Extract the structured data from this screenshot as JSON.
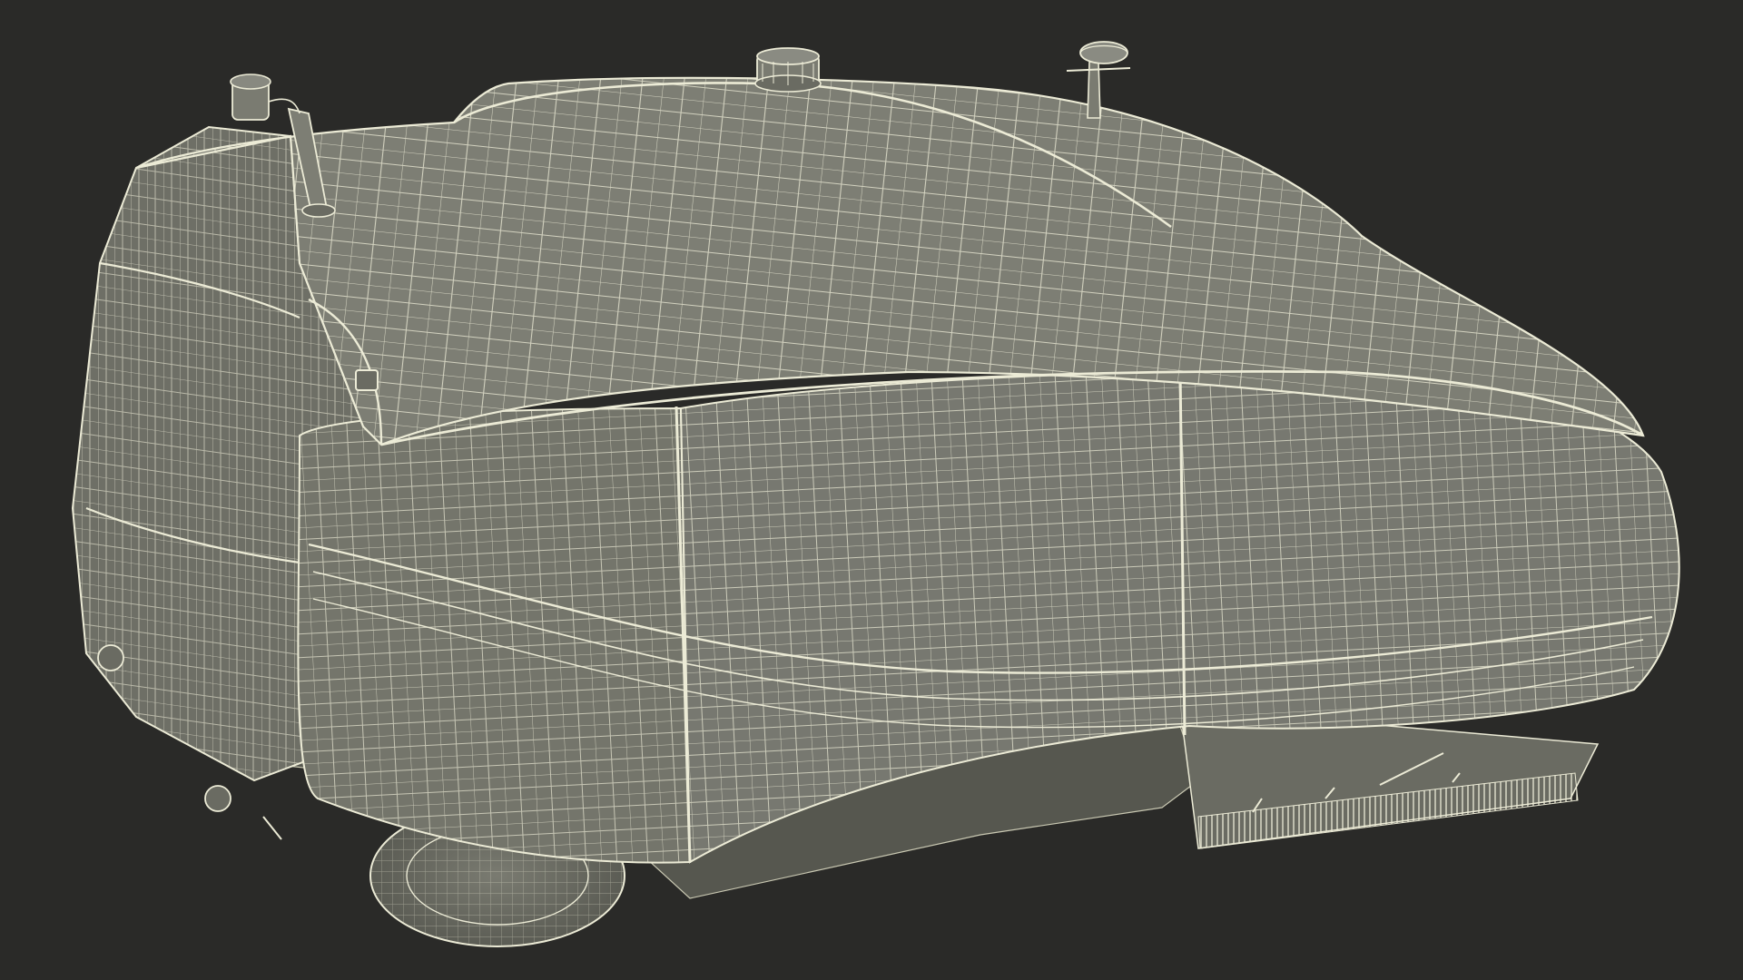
{
  "scene": {
    "subject": "robotic-lawn-mower-wireframe",
    "colors": {
      "background": "#2a2a28",
      "surface": "#7a7b71",
      "surface_dark": "#6a6b62",
      "underside": "#56574f",
      "wire": "#ecebd6",
      "wire_dim": "#c9c8b2"
    },
    "components": [
      "body-shell-icon",
      "side-panel-icon",
      "front-panel-icon",
      "lidar-sensor-icon",
      "gps-antenna-icon",
      "mast-beacon-icon",
      "rear-wheel-icon",
      "rear-brush-icon"
    ]
  }
}
